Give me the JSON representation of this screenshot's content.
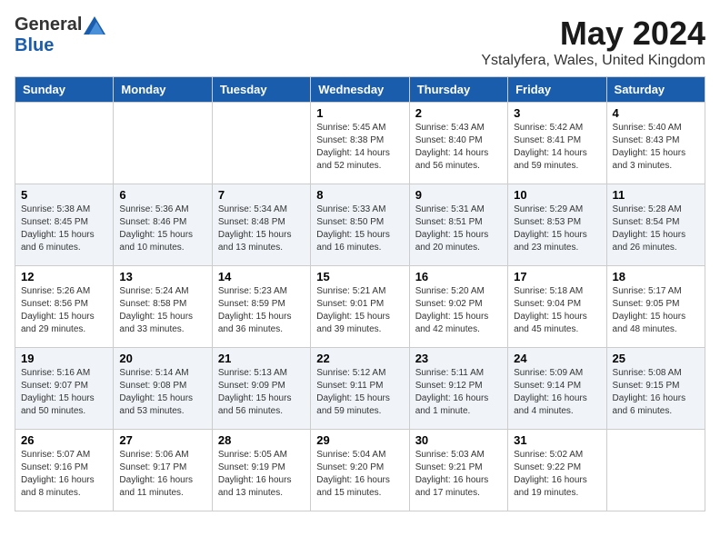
{
  "logo": {
    "general": "General",
    "blue": "Blue"
  },
  "title": {
    "month": "May 2024",
    "location": "Ystalyfera, Wales, United Kingdom"
  },
  "days_of_week": [
    "Sunday",
    "Monday",
    "Tuesday",
    "Wednesday",
    "Thursday",
    "Friday",
    "Saturday"
  ],
  "weeks": [
    [
      {
        "day": "",
        "info": ""
      },
      {
        "day": "",
        "info": ""
      },
      {
        "day": "",
        "info": ""
      },
      {
        "day": "1",
        "info": "Sunrise: 5:45 AM\nSunset: 8:38 PM\nDaylight: 14 hours and 52 minutes."
      },
      {
        "day": "2",
        "info": "Sunrise: 5:43 AM\nSunset: 8:40 PM\nDaylight: 14 hours and 56 minutes."
      },
      {
        "day": "3",
        "info": "Sunrise: 5:42 AM\nSunset: 8:41 PM\nDaylight: 14 hours and 59 minutes."
      },
      {
        "day": "4",
        "info": "Sunrise: 5:40 AM\nSunset: 8:43 PM\nDaylight: 15 hours and 3 minutes."
      }
    ],
    [
      {
        "day": "5",
        "info": "Sunrise: 5:38 AM\nSunset: 8:45 PM\nDaylight: 15 hours and 6 minutes."
      },
      {
        "day": "6",
        "info": "Sunrise: 5:36 AM\nSunset: 8:46 PM\nDaylight: 15 hours and 10 minutes."
      },
      {
        "day": "7",
        "info": "Sunrise: 5:34 AM\nSunset: 8:48 PM\nDaylight: 15 hours and 13 minutes."
      },
      {
        "day": "8",
        "info": "Sunrise: 5:33 AM\nSunset: 8:50 PM\nDaylight: 15 hours and 16 minutes."
      },
      {
        "day": "9",
        "info": "Sunrise: 5:31 AM\nSunset: 8:51 PM\nDaylight: 15 hours and 20 minutes."
      },
      {
        "day": "10",
        "info": "Sunrise: 5:29 AM\nSunset: 8:53 PM\nDaylight: 15 hours and 23 minutes."
      },
      {
        "day": "11",
        "info": "Sunrise: 5:28 AM\nSunset: 8:54 PM\nDaylight: 15 hours and 26 minutes."
      }
    ],
    [
      {
        "day": "12",
        "info": "Sunrise: 5:26 AM\nSunset: 8:56 PM\nDaylight: 15 hours and 29 minutes."
      },
      {
        "day": "13",
        "info": "Sunrise: 5:24 AM\nSunset: 8:58 PM\nDaylight: 15 hours and 33 minutes."
      },
      {
        "day": "14",
        "info": "Sunrise: 5:23 AM\nSunset: 8:59 PM\nDaylight: 15 hours and 36 minutes."
      },
      {
        "day": "15",
        "info": "Sunrise: 5:21 AM\nSunset: 9:01 PM\nDaylight: 15 hours and 39 minutes."
      },
      {
        "day": "16",
        "info": "Sunrise: 5:20 AM\nSunset: 9:02 PM\nDaylight: 15 hours and 42 minutes."
      },
      {
        "day": "17",
        "info": "Sunrise: 5:18 AM\nSunset: 9:04 PM\nDaylight: 15 hours and 45 minutes."
      },
      {
        "day": "18",
        "info": "Sunrise: 5:17 AM\nSunset: 9:05 PM\nDaylight: 15 hours and 48 minutes."
      }
    ],
    [
      {
        "day": "19",
        "info": "Sunrise: 5:16 AM\nSunset: 9:07 PM\nDaylight: 15 hours and 50 minutes."
      },
      {
        "day": "20",
        "info": "Sunrise: 5:14 AM\nSunset: 9:08 PM\nDaylight: 15 hours and 53 minutes."
      },
      {
        "day": "21",
        "info": "Sunrise: 5:13 AM\nSunset: 9:09 PM\nDaylight: 15 hours and 56 minutes."
      },
      {
        "day": "22",
        "info": "Sunrise: 5:12 AM\nSunset: 9:11 PM\nDaylight: 15 hours and 59 minutes."
      },
      {
        "day": "23",
        "info": "Sunrise: 5:11 AM\nSunset: 9:12 PM\nDaylight: 16 hours and 1 minute."
      },
      {
        "day": "24",
        "info": "Sunrise: 5:09 AM\nSunset: 9:14 PM\nDaylight: 16 hours and 4 minutes."
      },
      {
        "day": "25",
        "info": "Sunrise: 5:08 AM\nSunset: 9:15 PM\nDaylight: 16 hours and 6 minutes."
      }
    ],
    [
      {
        "day": "26",
        "info": "Sunrise: 5:07 AM\nSunset: 9:16 PM\nDaylight: 16 hours and 8 minutes."
      },
      {
        "day": "27",
        "info": "Sunrise: 5:06 AM\nSunset: 9:17 PM\nDaylight: 16 hours and 11 minutes."
      },
      {
        "day": "28",
        "info": "Sunrise: 5:05 AM\nSunset: 9:19 PM\nDaylight: 16 hours and 13 minutes."
      },
      {
        "day": "29",
        "info": "Sunrise: 5:04 AM\nSunset: 9:20 PM\nDaylight: 16 hours and 15 minutes."
      },
      {
        "day": "30",
        "info": "Sunrise: 5:03 AM\nSunset: 9:21 PM\nDaylight: 16 hours and 17 minutes."
      },
      {
        "day": "31",
        "info": "Sunrise: 5:02 AM\nSunset: 9:22 PM\nDaylight: 16 hours and 19 minutes."
      },
      {
        "day": "",
        "info": ""
      }
    ]
  ]
}
